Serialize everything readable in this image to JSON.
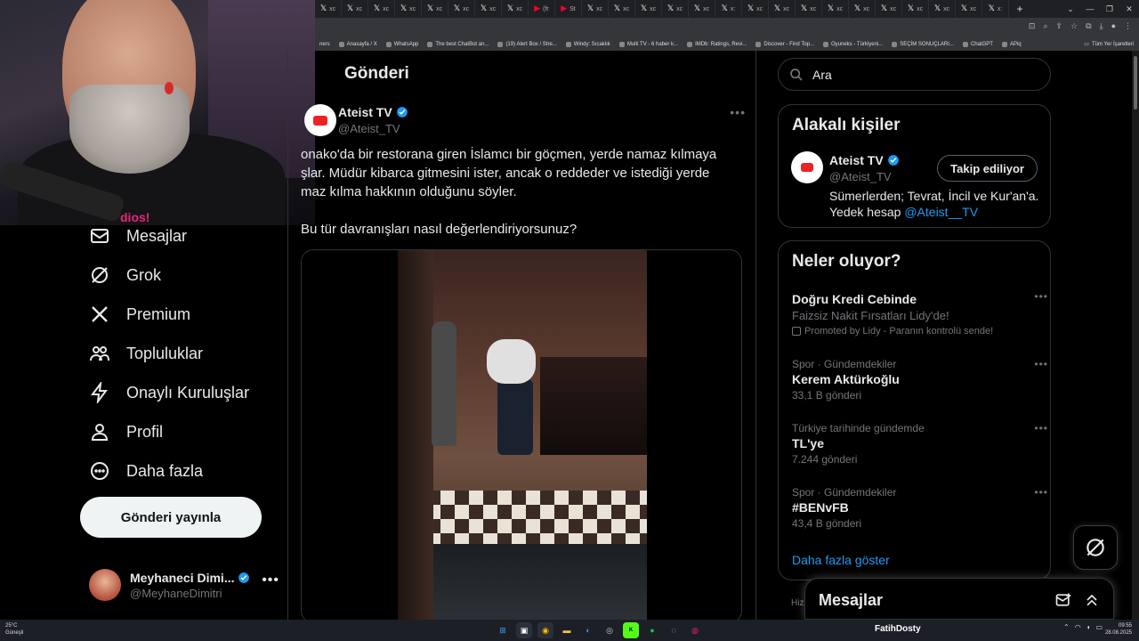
{
  "browser": {
    "tabs": [
      {
        "glyph": "𝕏",
        "label": "xc"
      },
      {
        "glyph": "𝕏",
        "label": "xc"
      },
      {
        "glyph": "𝕏",
        "label": "xc"
      },
      {
        "glyph": "𝕏",
        "label": "xc"
      },
      {
        "glyph": "𝕏",
        "label": "xc"
      },
      {
        "glyph": "𝕏",
        "label": "xc"
      },
      {
        "glyph": "𝕏",
        "label": "xc"
      },
      {
        "glyph": "𝕏",
        "label": "xc"
      },
      {
        "glyph": "▶",
        "label": "(fr"
      },
      {
        "glyph": "▶",
        "label": "St"
      },
      {
        "glyph": "𝕏",
        "label": "xc"
      },
      {
        "glyph": "𝕏",
        "label": "xc"
      },
      {
        "glyph": "𝕏",
        "label": "xc"
      },
      {
        "glyph": "𝕏",
        "label": "xc"
      },
      {
        "glyph": "𝕏",
        "label": "xc"
      },
      {
        "glyph": "𝕏",
        "label": "x:"
      },
      {
        "glyph": "𝕏",
        "label": "xc"
      },
      {
        "glyph": "𝕏",
        "label": "xc"
      },
      {
        "glyph": "𝕏",
        "label": "xc"
      },
      {
        "glyph": "𝕏",
        "label": "xc"
      },
      {
        "glyph": "𝕏",
        "label": "xc"
      },
      {
        "glyph": "𝕏",
        "label": "xc"
      },
      {
        "glyph": "𝕏",
        "label": "xc"
      },
      {
        "glyph": "𝕏",
        "label": "xc"
      },
      {
        "glyph": "𝕏",
        "label": "xc"
      },
      {
        "glyph": "𝕏",
        "label": "x:"
      }
    ],
    "new_tab": "+",
    "bookmarks": [
      "ners",
      "Anasayfa / X",
      "WhatsApp",
      "The best ChatBot an...",
      "(19) Alert Box / Stre...",
      "Windy: Sıcaklık",
      "Multi TV - 6 haber k...",
      "IMDb: Ratings, Revi...",
      "Discover - Find Top...",
      "Oyuneks - Türkiyeni...",
      "SEÇİM SONUÇLARI...",
      "ChatGPT",
      "APiq"
    ],
    "all_bookmarks": "Tüm Yer İşaretleri"
  },
  "webcam": {
    "shirt_text": "dios!"
  },
  "nav": {
    "items": [
      {
        "label": "Mesajlar",
        "icon": "envelope-icon"
      },
      {
        "label": "Grok",
        "icon": "grok-icon"
      },
      {
        "label": "Premium",
        "icon": "x-logo-icon"
      },
      {
        "label": "Topluluklar",
        "icon": "people-icon"
      },
      {
        "label": "Onaylı Kuruluşlar",
        "icon": "lightning-icon"
      },
      {
        "label": "Profil",
        "icon": "person-icon"
      },
      {
        "label": "Daha fazla",
        "icon": "more-circle-icon"
      }
    ],
    "post_button": "Gönderi yayınla",
    "account": {
      "name": "Meyhaneci Dimi...",
      "handle": "@MeyhaneDimitri",
      "more": "•••"
    }
  },
  "main": {
    "header": "Gönderi",
    "tweet": {
      "name": "Ateist TV",
      "handle": "@Ateist_TV",
      "more": "•••",
      "text_line1": "onako'da bir restorana giren İslamcı bir göçmen, yerde namaz kılmaya",
      "text_line2": "şlar. Müdür kibarca gitmesini ister, ancak o reddeder ve istediği yerde",
      "text_line3": "maz kılma hakkının olduğunu söyler.",
      "text_line4": "Bu tür davranışları nasıl değerlendiriyorsunuz?"
    }
  },
  "search": {
    "placeholder": "Ara"
  },
  "related": {
    "title": "Alakalı kişiler",
    "name": "Ateist TV",
    "handle": "@Ateist_TV",
    "follow_label": "Takip ediliyor",
    "bio": "Sümerlerden; Tevrat, İncil ve Kur'an'a. Yedek hesap ",
    "bio_link": "@Ateist__TV"
  },
  "trends": {
    "title": "Neler oluyor?",
    "items": [
      {
        "context": "",
        "name": "Doğru Kredi Cebinde",
        "sub": "Faizsiz Nakit Fırsatları Lidy'de!",
        "promo": "Promoted by Lidy - Paranın kontrolü sende!",
        "count": ""
      },
      {
        "context": "Spor · Gündemdekiler",
        "name": "Kerem Aktürkoğlu",
        "count": "33,1 B gönderi"
      },
      {
        "context": "Türkiye tarihinde gündemde",
        "name": "TL'ye",
        "count": "7.244 gönderi"
      },
      {
        "context": "Spor · Gündemdekiler",
        "name": "#BENvFB",
        "count": "43,4 B gönderi"
      }
    ],
    "more_glyph": "•••",
    "show_more": "Daha fazla göster",
    "footer_partial": "Hizm"
  },
  "messages_drawer": {
    "title": "Mesajlar"
  },
  "taskbar": {
    "weather_temp": "25°C",
    "weather_desc": "Güneşli",
    "streamer": "FatihDosty",
    "time": "09:55",
    "date": "28.08.2025"
  },
  "colors": {
    "accent": "#1d9bf0",
    "background": "#000000",
    "border": "#2f3336",
    "muted": "#71767b"
  }
}
